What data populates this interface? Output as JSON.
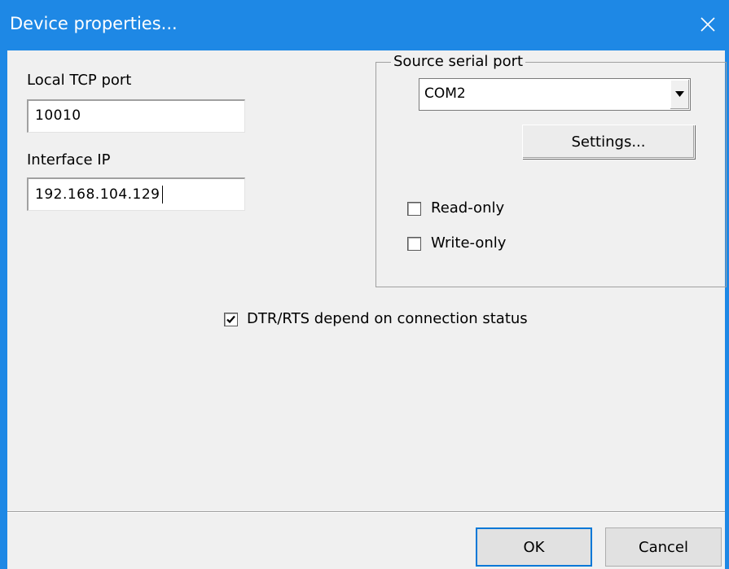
{
  "window": {
    "title": "Device properties...",
    "close_icon": "close-icon",
    "accent_color": "#1e88e5"
  },
  "local_tcp_port": {
    "label": "Local TCP port",
    "value": "10010"
  },
  "interface_ip": {
    "label": "Interface IP",
    "value": "192.168.104.129"
  },
  "source_serial_port": {
    "legend": "Source serial port",
    "selected": "COM2",
    "settings_label": "Settings...",
    "read_only": {
      "label": "Read-only",
      "checked": false
    },
    "write_only": {
      "label": "Write-only",
      "checked": false
    }
  },
  "dtr_rts": {
    "label": "DTR/RTS depend on connection status",
    "checked": true
  },
  "footer": {
    "ok_label": "OK",
    "cancel_label": "Cancel"
  }
}
